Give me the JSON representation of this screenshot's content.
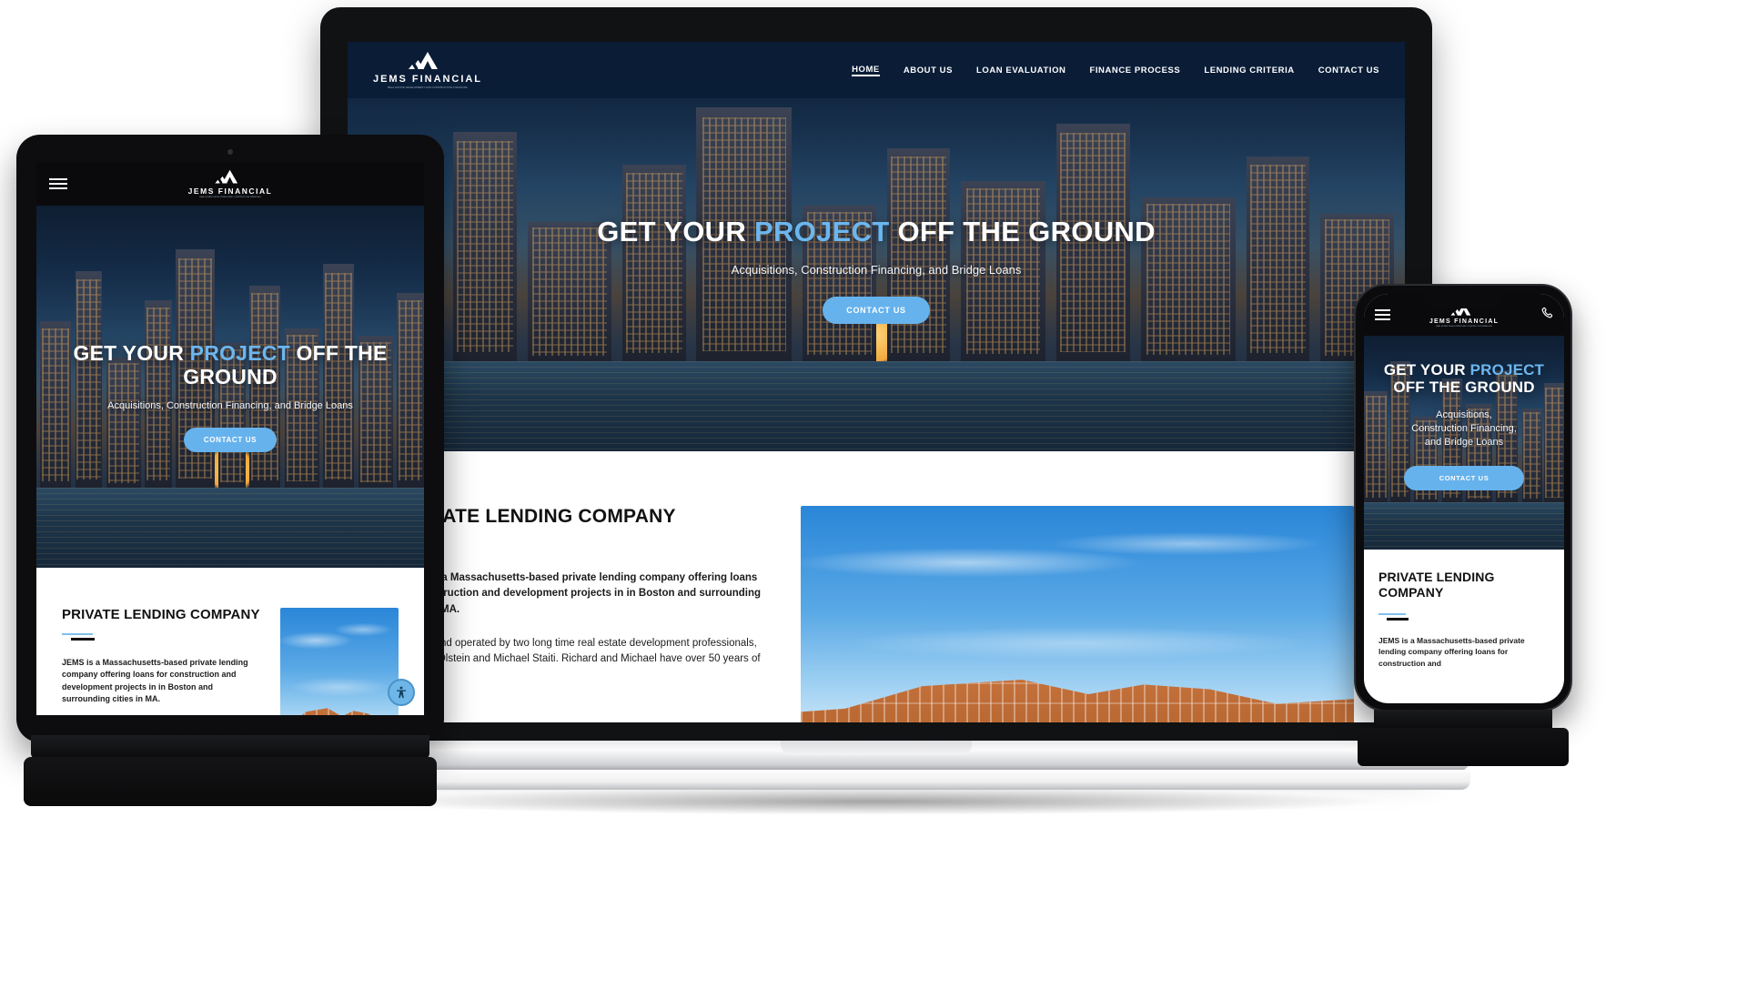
{
  "brand": {
    "name": "JEMS FINANCIAL",
    "tagline": "REAL ESTATE DEVELOPMENT AND CONSTRUCTION FINANCING",
    "logo_icon": "mountain-chevron-logo-icon",
    "accent_blue": "#6cb6ef",
    "button_blue": "#66b2ec",
    "nav_bg": "#0a1c36",
    "dark": "#0b0b0d"
  },
  "nav": {
    "items": [
      {
        "label": "HOME",
        "active": true
      },
      {
        "label": "ABOUT US",
        "active": false
      },
      {
        "label": "LOAN EVALUATION",
        "active": false
      },
      {
        "label": "FINANCE PROCESS",
        "active": false
      },
      {
        "label": "LENDING CRITERIA",
        "active": false
      },
      {
        "label": "CONTACT US",
        "active": false
      }
    ]
  },
  "hero": {
    "title_part1": "GET YOUR ",
    "title_highlight": "PROJECT",
    "title_part2": " OFF THE GROUND",
    "title_mobile_line1_part1": "GET YOUR ",
    "title_mobile_line1_hl": "PROJECT",
    "title_mobile_line2": "OFF THE GROUND",
    "subtitle": "Acquisitions, Construction Financing, and Bridge Loans",
    "subtitle_m1": "Acquisitions,",
    "subtitle_m2": "Construction Financing,",
    "subtitle_m3": "and Bridge Loans",
    "cta_label": "CONTACT US",
    "background_image": "boston-skyline-night-harbor"
  },
  "content": {
    "heading": "PRIVATE LENDING COMPANY",
    "heading_m1": "PRIVATE LENDING",
    "heading_m2": "COMPANY",
    "paragraph1": "JEMS is a Massachusetts-based private lending company offering loans for construction and development projects in in Boston and surrounding cities in MA.",
    "paragraph2": "Owned and operated by two long time real estate development professionals, Richard Olstein and Michael Staiti. Richard and Michael have over 50 years of real",
    "paragraph1_phone": "JEMS is a Massachusetts-based private lending company offering loans for construction and",
    "image_alt": "wood-frame-house-construction-photo"
  },
  "mobile_header": {
    "menu_icon": "hamburger-menu-icon",
    "call_icon": "phone-call-icon"
  },
  "widgets": {
    "accessibility_icon": "accessibility-person-icon"
  },
  "devices": {
    "laptop": "laptop-mockup",
    "tablet": "tablet-mockup",
    "phone": "phone-mockup"
  }
}
